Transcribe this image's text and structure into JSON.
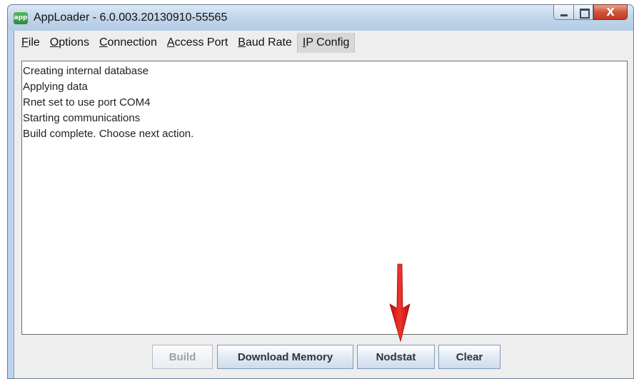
{
  "window": {
    "app_icon_label": "app",
    "title": "AppLoader - 6.0.003.20130910-55565",
    "controls": {
      "minimize": "–",
      "maximize": "□",
      "close": "X"
    }
  },
  "menu": {
    "items": [
      {
        "mnemonic": "F",
        "rest": "ile"
      },
      {
        "mnemonic": "O",
        "rest": "ptions"
      },
      {
        "mnemonic": "C",
        "rest": "onnection"
      },
      {
        "mnemonic": "A",
        "rest": "ccess Port"
      },
      {
        "mnemonic": "B",
        "rest": "aud Rate"
      },
      {
        "mnemonic": "I",
        "rest": "P Config"
      }
    ]
  },
  "log": {
    "lines": [
      "Creating internal database",
      "Applying data",
      "Rnet set to use port COM4",
      "Starting communications",
      "Build complete.  Choose next action."
    ]
  },
  "buttons": {
    "build": "Build",
    "download_memory": "Download Memory",
    "nodstat": "Nodstat",
    "clear": "Clear"
  },
  "colors": {
    "annotation_arrow": "#e8201c",
    "title_bar": "#c3d7ec",
    "close_button": "#c9442b"
  },
  "icons": [
    "app-icon",
    "minimize-icon",
    "maximize-icon",
    "close-icon",
    "red-arrow-annotation"
  ]
}
